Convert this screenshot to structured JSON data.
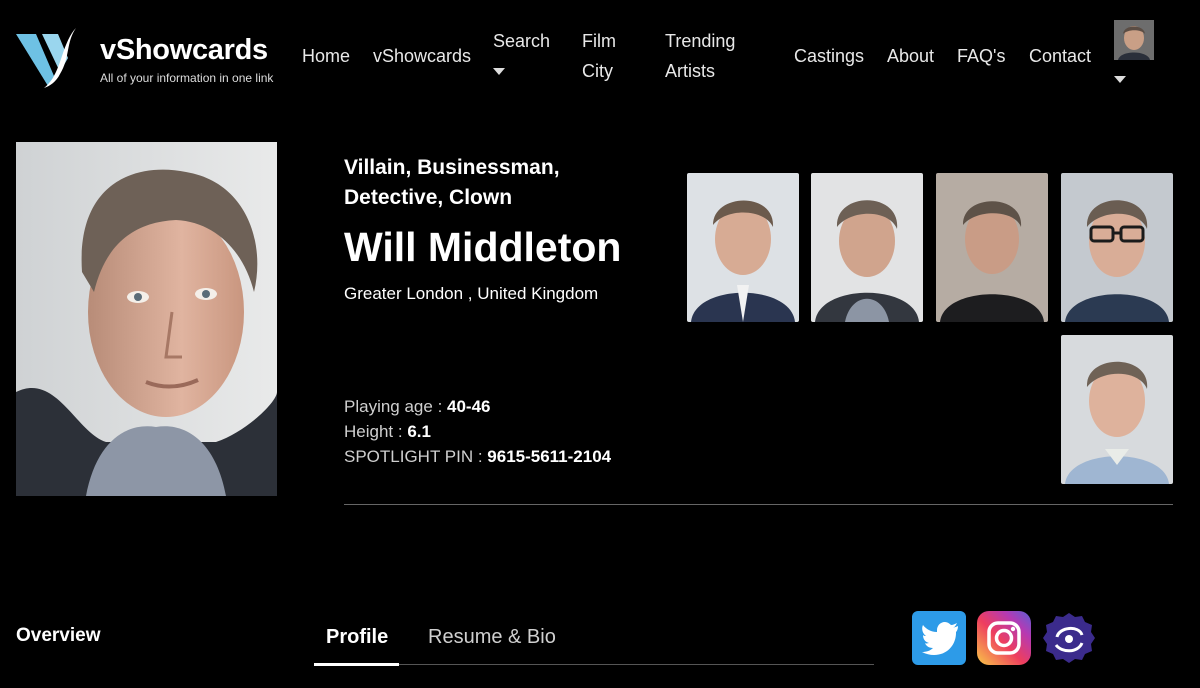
{
  "brand": {
    "name": "vShowcards",
    "tagline": "All of your information in one link",
    "accent": "#7ec8e3"
  },
  "nav": {
    "home": "Home",
    "vshowcards": "vShowcards",
    "search": "Search",
    "film_city": [
      "Film",
      "City"
    ],
    "trending_artists": [
      "Trending",
      "Artists"
    ],
    "castings": "Castings",
    "about": "About",
    "faqs": "FAQ's",
    "contact": "Contact"
  },
  "profile": {
    "roles": "Villain, Businessman, Detective, Clown",
    "name": "Will Middleton",
    "location": "Greater London , United Kingdom",
    "playing_age_label": "Playing age : ",
    "playing_age": "40-46",
    "height_label": "Height : ",
    "height": "6.1",
    "spotlight_label": "SPOTLIGHT PIN : ",
    "spotlight_pin": "9615-5611-2104"
  },
  "sections": {
    "overview": "Overview",
    "tabs": [
      "Profile",
      "Resume & Bio"
    ],
    "active_tab": "Profile"
  },
  "social": [
    {
      "name": "twitter",
      "color": "#2d9be8"
    },
    {
      "name": "instagram",
      "color": "#d6336c"
    },
    {
      "name": "spotlight",
      "color": "#3a2a8a"
    }
  ],
  "photos": {
    "thumbnail_count": 5
  }
}
